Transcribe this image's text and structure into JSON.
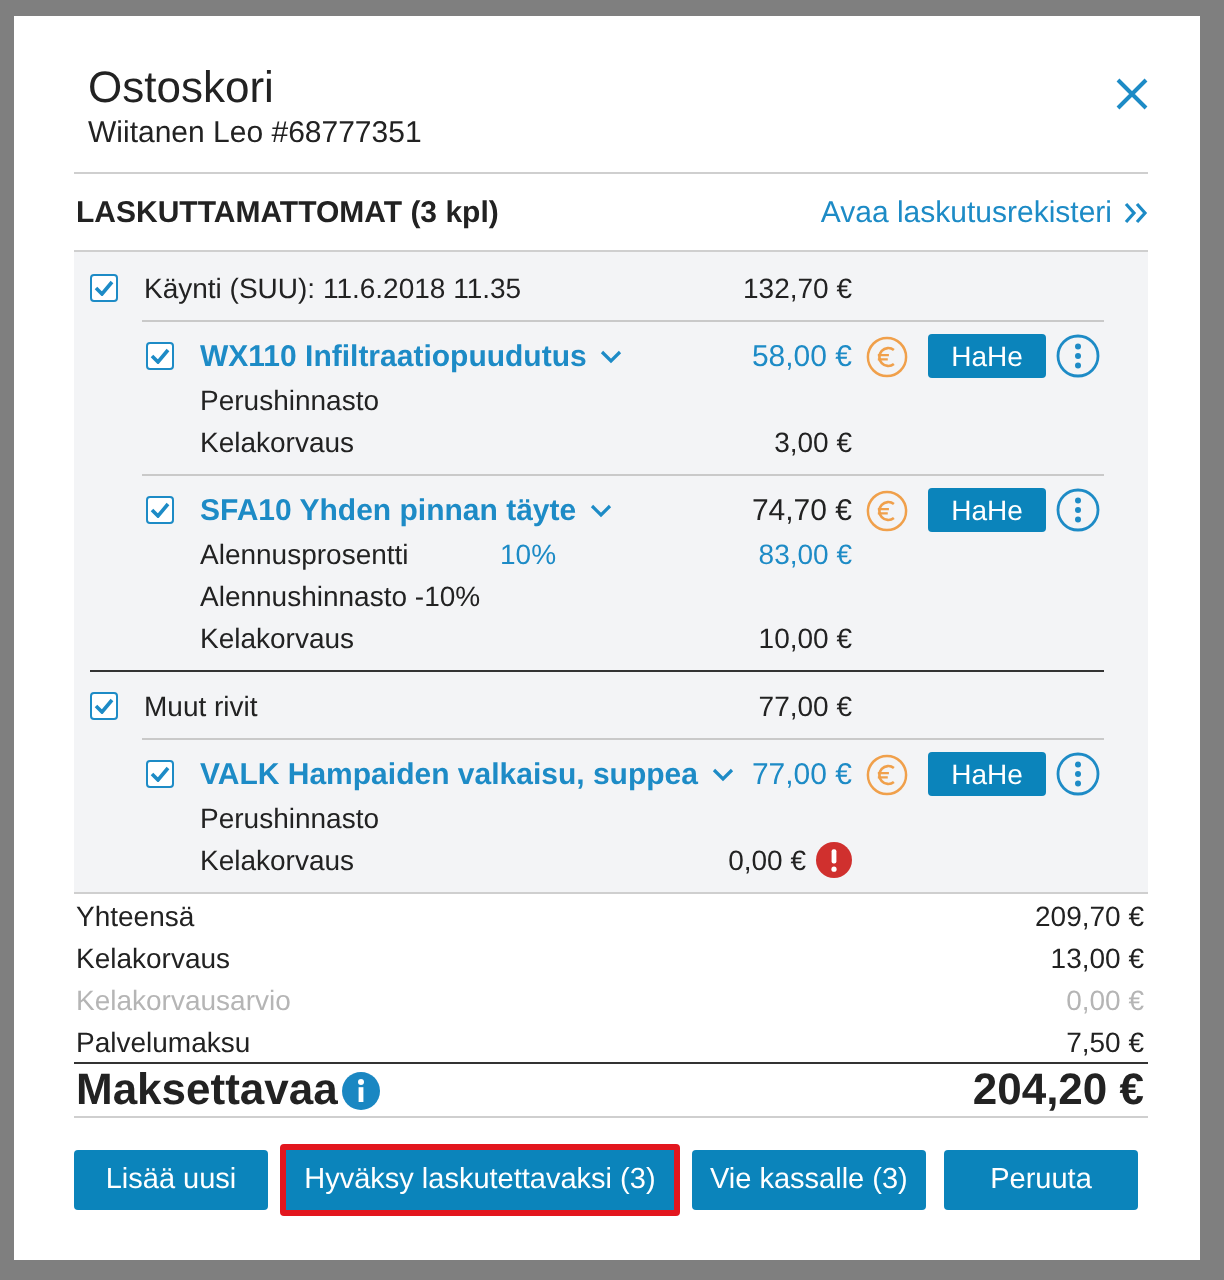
{
  "dialog": {
    "title": "Ostoskori",
    "subtitle": "Wiitanen Leo #68777351"
  },
  "section": {
    "title": "LASKUTTAMATTOMAT (3 kpl)",
    "link": "Avaa laskutusrekisteri"
  },
  "groups": [
    {
      "label": "Käynti (SUU): 11.6.2018 11.35",
      "amount": "132,70 €",
      "checked": true,
      "items": [
        {
          "name": "WX110 Infiltraatiopuudutus",
          "price": "58,00 €",
          "price_editable": true,
          "checked": true,
          "tag": "HaHe",
          "details": [
            {
              "label": "Perushinnasto"
            },
            {
              "label": "Kelakorvaus",
              "amount": "3,00 €",
              "amount_editable": false,
              "warning": false
            }
          ]
        },
        {
          "name": "SFA10 Yhden pinnan täyte",
          "price": "74,70 €",
          "price_editable": false,
          "checked": true,
          "tag": "HaHe",
          "details": [
            {
              "label": "Alennusprosentti",
              "percent": "10%",
              "amount": "83,00 €",
              "amount_editable": true,
              "warning": false
            },
            {
              "label": "Alennushinnasto -10%"
            },
            {
              "label": "Kelakorvaus",
              "amount": "10,00 €",
              "amount_editable": false,
              "warning": false
            }
          ]
        }
      ]
    },
    {
      "label": "Muut rivit",
      "amount": "77,00 €",
      "checked": true,
      "items": [
        {
          "name": "VALK Hampaiden valkaisu, suppea",
          "price": "77,00 €",
          "price_editable": true,
          "checked": true,
          "tag": "HaHe",
          "details": [
            {
              "label": "Perushinnasto"
            },
            {
              "label": "Kelakorvaus",
              "amount": "0,00 €",
              "amount_editable": false,
              "warning": true
            }
          ]
        }
      ]
    }
  ],
  "summary": [
    {
      "label": "Yhteensä",
      "amount": "209,70 €",
      "disabled": false
    },
    {
      "label": "Kelakorvaus",
      "amount": "13,00 €",
      "disabled": false
    },
    {
      "label": "Kelakorvausarvio",
      "amount": "0,00 €",
      "disabled": true
    },
    {
      "label": "Palvelumaksu",
      "amount": "7,50 €",
      "disabled": false
    }
  ],
  "total": {
    "label": "Maksettavaa",
    "amount": "204,20 €"
  },
  "buttons": [
    {
      "label": "Lisää uusi",
      "highlighted": false
    },
    {
      "label": "Hyväksy laskutettavaksi (3)",
      "highlighted": true
    },
    {
      "label": "Vie kassalle (3)",
      "highlighted": false
    },
    {
      "label": "Peruuta",
      "highlighted": false
    }
  ]
}
